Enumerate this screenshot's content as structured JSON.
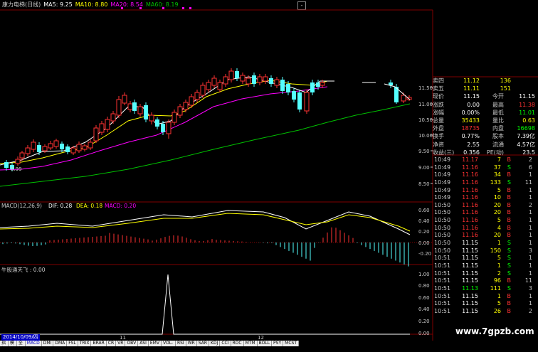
{
  "header": {
    "stock_name": "康力电梯(日线)",
    "ma5": "MA5: 9.25",
    "ma10": "MA10: 8.80",
    "ma20": "MA20: 8.54",
    "ma60": "MA60: 8.19"
  },
  "colors": {
    "up": "#ff3232",
    "down": "#54ffff",
    "ma5": "#ffffff",
    "ma10": "#ffff00",
    "ma20": "#ff00ff",
    "ma60": "#00c000",
    "grid": "#800000"
  },
  "price_axis": [
    "11.50",
    "11.00",
    "10.50",
    "10.00",
    "9.50",
    "9.00",
    "8.50"
  ],
  "low_label": "8.99",
  "macd": {
    "title": "MACD(12,26,9)",
    "dif": "DIF: 0.28",
    "dea": "DEA: 0.18",
    "macd": "MACD: 0.20",
    "axis": [
      "0.60",
      "0.40",
      "0.20",
      "0.00",
      "-0.20"
    ]
  },
  "indicator": {
    "title": "牛股通天飞 : 0.00",
    "axis": [
      "1.00",
      "0.80",
      "0.60",
      "0.40",
      "0.20",
      "0.00"
    ]
  },
  "date_label": "2014/10/09/四",
  "x_labels": [
    "11",
    "12"
  ],
  "quote": [
    {
      "label": "卖四",
      "val": "11.12",
      "val_color": "#ffff00",
      "vol": "136",
      "extra": ""
    },
    {
      "label": "卖五",
      "val": "11.11",
      "val_color": "#ffff00",
      "vol": "151",
      "extra": ""
    },
    {
      "label": "现价",
      "val": "11.15",
      "val_color": "#ffffff",
      "vol": "今开",
      "vol_color": "#c8c8c8",
      "extra": "11.15",
      "extra_color": "#ffffff"
    },
    {
      "label": "涨跌",
      "val": "0.00",
      "val_color": "#ffffff",
      "vol": "最高",
      "vol_color": "#c8c8c8",
      "extra": "11.38",
      "extra_color": "#ff3232"
    },
    {
      "label": "涨幅",
      "val": "0.00%",
      "val_color": "#ffffff",
      "vol": "最低",
      "vol_color": "#c8c8c8",
      "extra": "11.01",
      "extra_color": "#00ff00"
    },
    {
      "label": "总量",
      "val": "35433",
      "val_color": "#ffff00",
      "vol": "量比",
      "vol_color": "#c8c8c8",
      "extra": "0.63",
      "extra_color": "#ffff00"
    },
    {
      "label": "外盘",
      "val": "18735",
      "val_color": "#ff3232",
      "vol": "内盘",
      "vol_color": "#c8c8c8",
      "extra": "16698",
      "extra_color": "#00ff00"
    },
    {
      "label": "换手",
      "val": "0.77%",
      "val_color": "#ffffff",
      "vol": "股本",
      "vol_color": "#c8c8c8",
      "extra": "7.39亿",
      "extra_color": "#ffffff"
    },
    {
      "label": "净资",
      "val": "2.55",
      "val_color": "#ffffff",
      "vol": "流通",
      "vol_color": "#c8c8c8",
      "extra": "4.57亿",
      "extra_color": "#ffffff"
    },
    {
      "label": "收益(三)",
      "val": "0.356",
      "val_color": "#ffffff",
      "vol": "PE(动)",
      "vol_color": "#c8c8c8",
      "extra": "23.5",
      "extra_color": "#ffffff"
    }
  ],
  "trades": [
    {
      "time": "10:49",
      "price": "11.17",
      "price_color": "#ff3232",
      "vol": "7",
      "side": "B",
      "n": "2"
    },
    {
      "time": "10:49",
      "price": "11.16",
      "price_color": "#ff3232",
      "vol": "37",
      "side": "S",
      "n": "6"
    },
    {
      "time": "10:49",
      "price": "11.16",
      "price_color": "#ff3232",
      "vol": "34",
      "side": "B",
      "n": "1"
    },
    {
      "time": "10:49",
      "price": "11.16",
      "price_color": "#ff3232",
      "vol": "133",
      "side": "S",
      "n": "11"
    },
    {
      "time": "10:49",
      "price": "11.16",
      "price_color": "#ff3232",
      "vol": "5",
      "side": "B",
      "n": "1"
    },
    {
      "time": "10:49",
      "price": "11.16",
      "price_color": "#ff3232",
      "vol": "10",
      "side": "B",
      "n": "1"
    },
    {
      "time": "10:50",
      "price": "11.16",
      "price_color": "#ff3232",
      "vol": "20",
      "side": "B",
      "n": "2"
    },
    {
      "time": "10:50",
      "price": "11.16",
      "price_color": "#ff3232",
      "vol": "20",
      "side": "B",
      "n": "1"
    },
    {
      "time": "10:50",
      "price": "11.16",
      "price_color": "#ff3232",
      "vol": "5",
      "side": "B",
      "n": "1"
    },
    {
      "time": "10:50",
      "price": "11.16",
      "price_color": "#ff3232",
      "vol": "4",
      "side": "B",
      "n": "1"
    },
    {
      "time": "10:50",
      "price": "11.16",
      "price_color": "#ff3232",
      "vol": "20",
      "side": "B",
      "n": "1"
    },
    {
      "time": "10:50",
      "price": "11.15",
      "price_color": "#ffffff",
      "vol": "1",
      "side": "S",
      "n": "1"
    },
    {
      "time": "10:50",
      "price": "11.15",
      "price_color": "#ffffff",
      "vol": "150",
      "side": "S",
      "n": "3"
    },
    {
      "time": "10:51",
      "price": "11.15",
      "price_color": "#ffffff",
      "vol": "5",
      "side": "S",
      "n": "1"
    },
    {
      "time": "10:51",
      "price": "11.15",
      "price_color": "#ffffff",
      "vol": "1",
      "side": "S",
      "n": "1"
    },
    {
      "time": "10:51",
      "price": "11.15",
      "price_color": "#ffffff",
      "vol": "2",
      "side": "S",
      "n": "1"
    },
    {
      "time": "10:51",
      "price": "11.15",
      "price_color": "#ffffff",
      "vol": "96",
      "side": "B",
      "n": "11"
    },
    {
      "time": "10:51",
      "price": "11.13",
      "price_color": "#00ff00",
      "vol": "111",
      "side": "S",
      "n": "3"
    },
    {
      "time": "10:51",
      "price": "11.15",
      "price_color": "#ffffff",
      "vol": "1",
      "side": "B",
      "n": "1"
    },
    {
      "time": "10:51",
      "price": "11.15",
      "price_color": "#ffffff",
      "vol": "5",
      "side": "B",
      "n": "1"
    },
    {
      "time": "10:51",
      "price": "11.15",
      "price_color": "#ffffff",
      "vol": "26",
      "side": "B",
      "n": "2"
    }
  ],
  "bottom_tabs": [
    "指标",
    "模板",
    "全部",
    "MACD",
    "DMI",
    "DMA",
    "FSL",
    "TRIX",
    "BRAR",
    "CR",
    "VR",
    "OBV",
    "ASI",
    "EMV",
    "VOL-TDX",
    "RSI",
    "WR",
    "SAR",
    "KDJ",
    "CCI",
    "ROC",
    "MTM",
    "BOLL",
    "PSY",
    "MCST"
  ],
  "watermark": "www.7gpzb.com",
  "scroll_button": "-"
}
